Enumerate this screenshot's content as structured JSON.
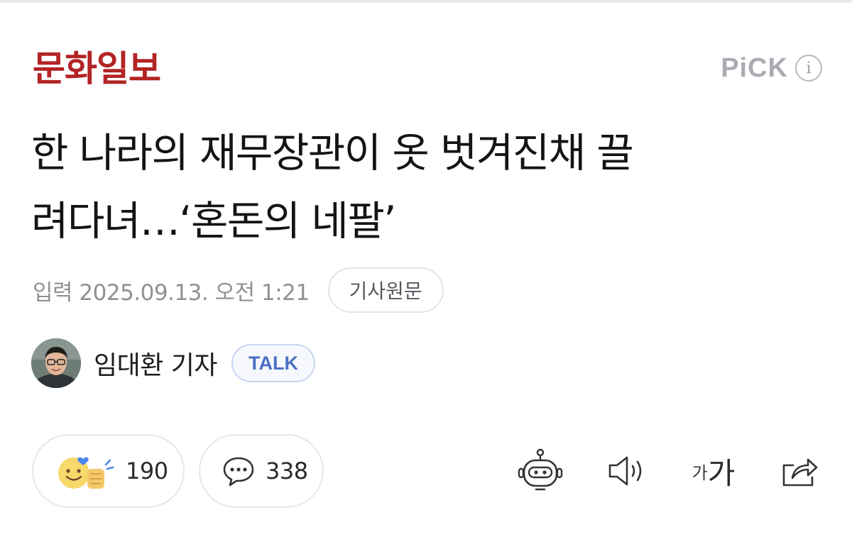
{
  "header": {
    "press_name": "문화일보",
    "pick_label": "PiCK",
    "info_symbol": "i"
  },
  "article": {
    "headline_line1": "한 나라의 재무장관이 옷 벗겨진채 끌",
    "headline_line2": "려다녀…‘혼돈의 네팔’",
    "date_prefix": "입력",
    "date": "2025.09.13. 오전 1:21",
    "origin_button": "기사원문"
  },
  "reporter": {
    "name": "임대환 기자",
    "talk_button": "TALK"
  },
  "actions": {
    "reaction_count": "190",
    "comment_count": "338",
    "font_small": "가",
    "font_big": "가"
  },
  "colors": {
    "press_red": "#b32424",
    "talk_blue": "#4a6fc4",
    "muted_gray": "#8e9196"
  },
  "icons": [
    "info-icon",
    "reaction-emoji-icon",
    "comment-icon",
    "ai-bot-icon",
    "speaker-icon",
    "font-size-icon",
    "share-icon"
  ]
}
